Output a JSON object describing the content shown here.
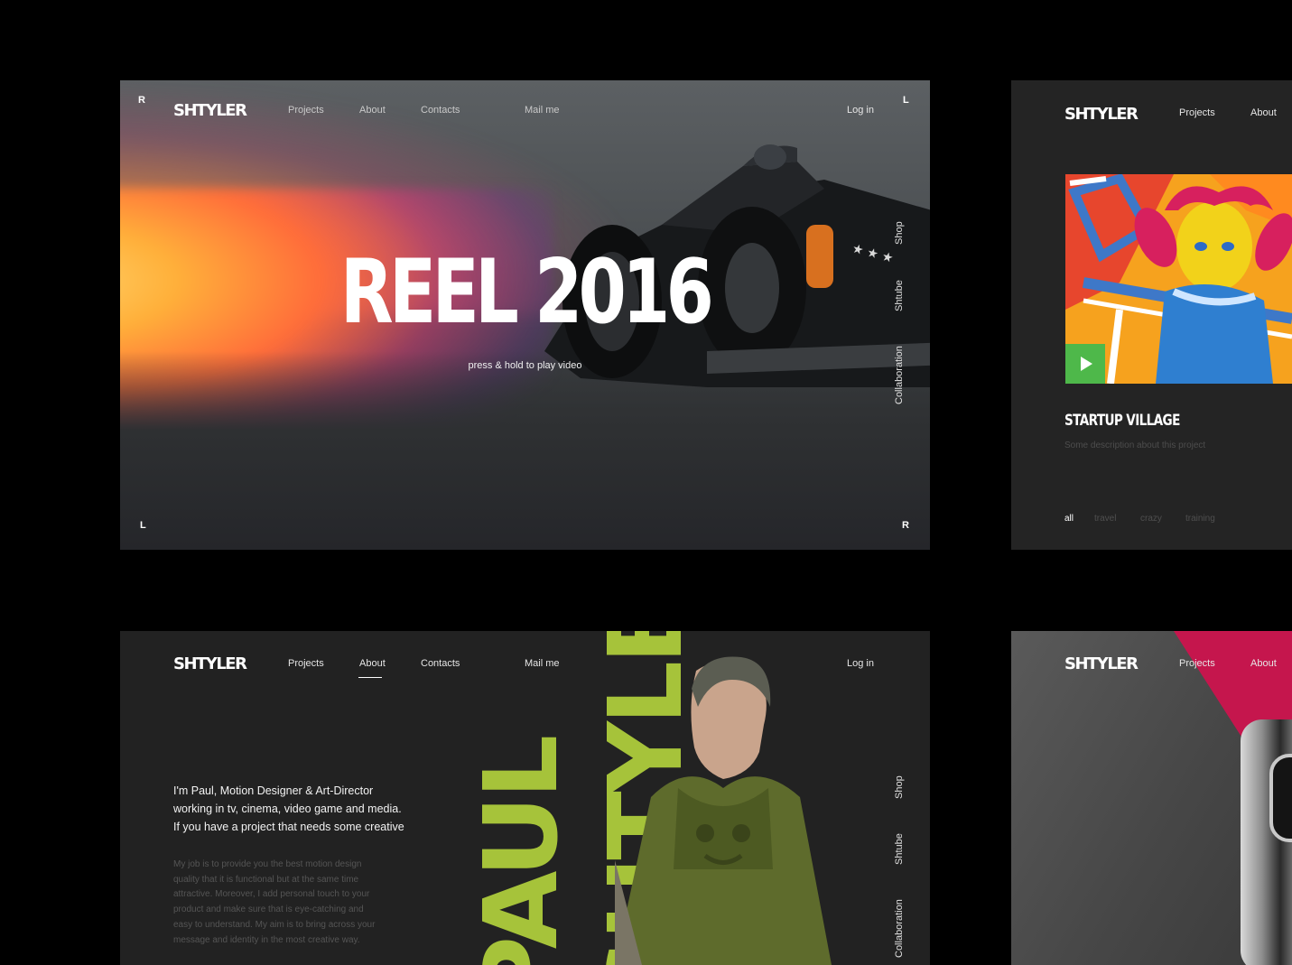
{
  "brand": {
    "logo": "SHTYLER"
  },
  "colors": {
    "accent_green": "#a6c33a",
    "accent_red": "#c5164d",
    "play_green": "#4eb84a"
  },
  "reel": {
    "nav": [
      "Projects",
      "About",
      "Contacts",
      "Mail me",
      "Log in"
    ],
    "corners": {
      "top_left": "R",
      "top_right": "L",
      "bottom_left": "L",
      "bottom_right": "R"
    },
    "side_nav": [
      "Shop",
      "Shtube",
      "Collaboration"
    ],
    "title": "REEL 2016",
    "subtitle": "press & hold to play video"
  },
  "startup": {
    "nav": [
      "Projects",
      "About"
    ],
    "project_title": "STARTUP VILLAGE",
    "project_description": "Some description about this project",
    "filters": [
      "all",
      "travel",
      "crazy",
      "training"
    ],
    "play_icon": "play-icon"
  },
  "about": {
    "nav": [
      "Projects",
      "About",
      "Contacts",
      "Mail me",
      "Log in"
    ],
    "active_nav": "About",
    "intro": [
      "I'm Paul, Motion Designer & Art-Director",
      "working in tv, cinema, video game and media.",
      "If you have a project that needs some creative"
    ],
    "body": [
      "My job is to provide you the best motion design",
      "quality that it is functional but at the same time",
      "attractive. Moreover, I add personal touch to your",
      "product and make sure that is eye-catching and",
      "easy to understand. My aim is to bring across your",
      "message and identity in the most creative way."
    ],
    "big_name_1": "PAUL",
    "big_name_2": "SHTYLER",
    "side_nav": [
      "Shop",
      "Shtube",
      "Collaboration"
    ]
  },
  "product": {
    "nav": [
      "Projects",
      "About"
    ]
  }
}
